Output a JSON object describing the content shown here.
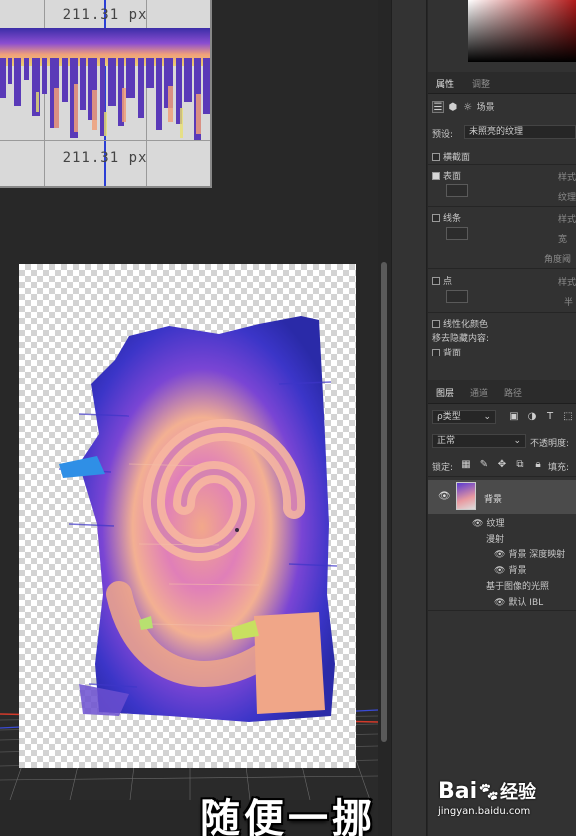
{
  "canvas": {
    "ruler": {
      "measure_top": "211.31 px",
      "measure_bottom": "211.31 px"
    },
    "subtitle": "随便一挪"
  },
  "properties_panel": {
    "tabs": [
      "属性",
      "调整"
    ],
    "header_label": "场景",
    "preset_label": "预设:",
    "preset_value": "未照亮的纹理",
    "cross_section": "横截面",
    "surface": "表面",
    "surface_right": [
      "样式",
      "纹理"
    ],
    "lines": "线条",
    "lines_right": [
      "样式",
      "宽",
      "角度阈"
    ],
    "points": "点",
    "points_right": [
      "样式",
      "半"
    ],
    "linearize_colors": "线性化颜色",
    "remove_hidden": "移去隐藏内容:",
    "back": "背面"
  },
  "layers_panel": {
    "tabs": [
      "图层",
      "通道",
      "路径"
    ],
    "filter_label": "ρ类型",
    "blend_mode": "正常",
    "opacity_label": "不透明度:",
    "lock_label": "锁定:",
    "fill_label": "填充:",
    "layers": [
      {
        "name": "背景",
        "indent": 0
      },
      {
        "name": "纹理",
        "indent": 1
      },
      {
        "name": "漫射",
        "indent": 2
      },
      {
        "name": "背景 深度映射",
        "indent": 3
      },
      {
        "name": "背景",
        "indent": 3
      },
      {
        "name": "基于图像的光照",
        "indent": 2
      },
      {
        "name": "默认 IBL",
        "indent": 3
      }
    ]
  },
  "watermark": {
    "brand": "Bai",
    "brand_suffix": "经验",
    "url": "jingyan.baidu.com"
  },
  "colors": {
    "selected_layer": "#4b4b4b",
    "panel_bg": "#323232",
    "canvas_bg": "#282828"
  },
  "icons": [
    "eye-icon",
    "lock-icon",
    "brush-icon",
    "move-icon",
    "layer-thumbnail",
    "paw-icon"
  ]
}
